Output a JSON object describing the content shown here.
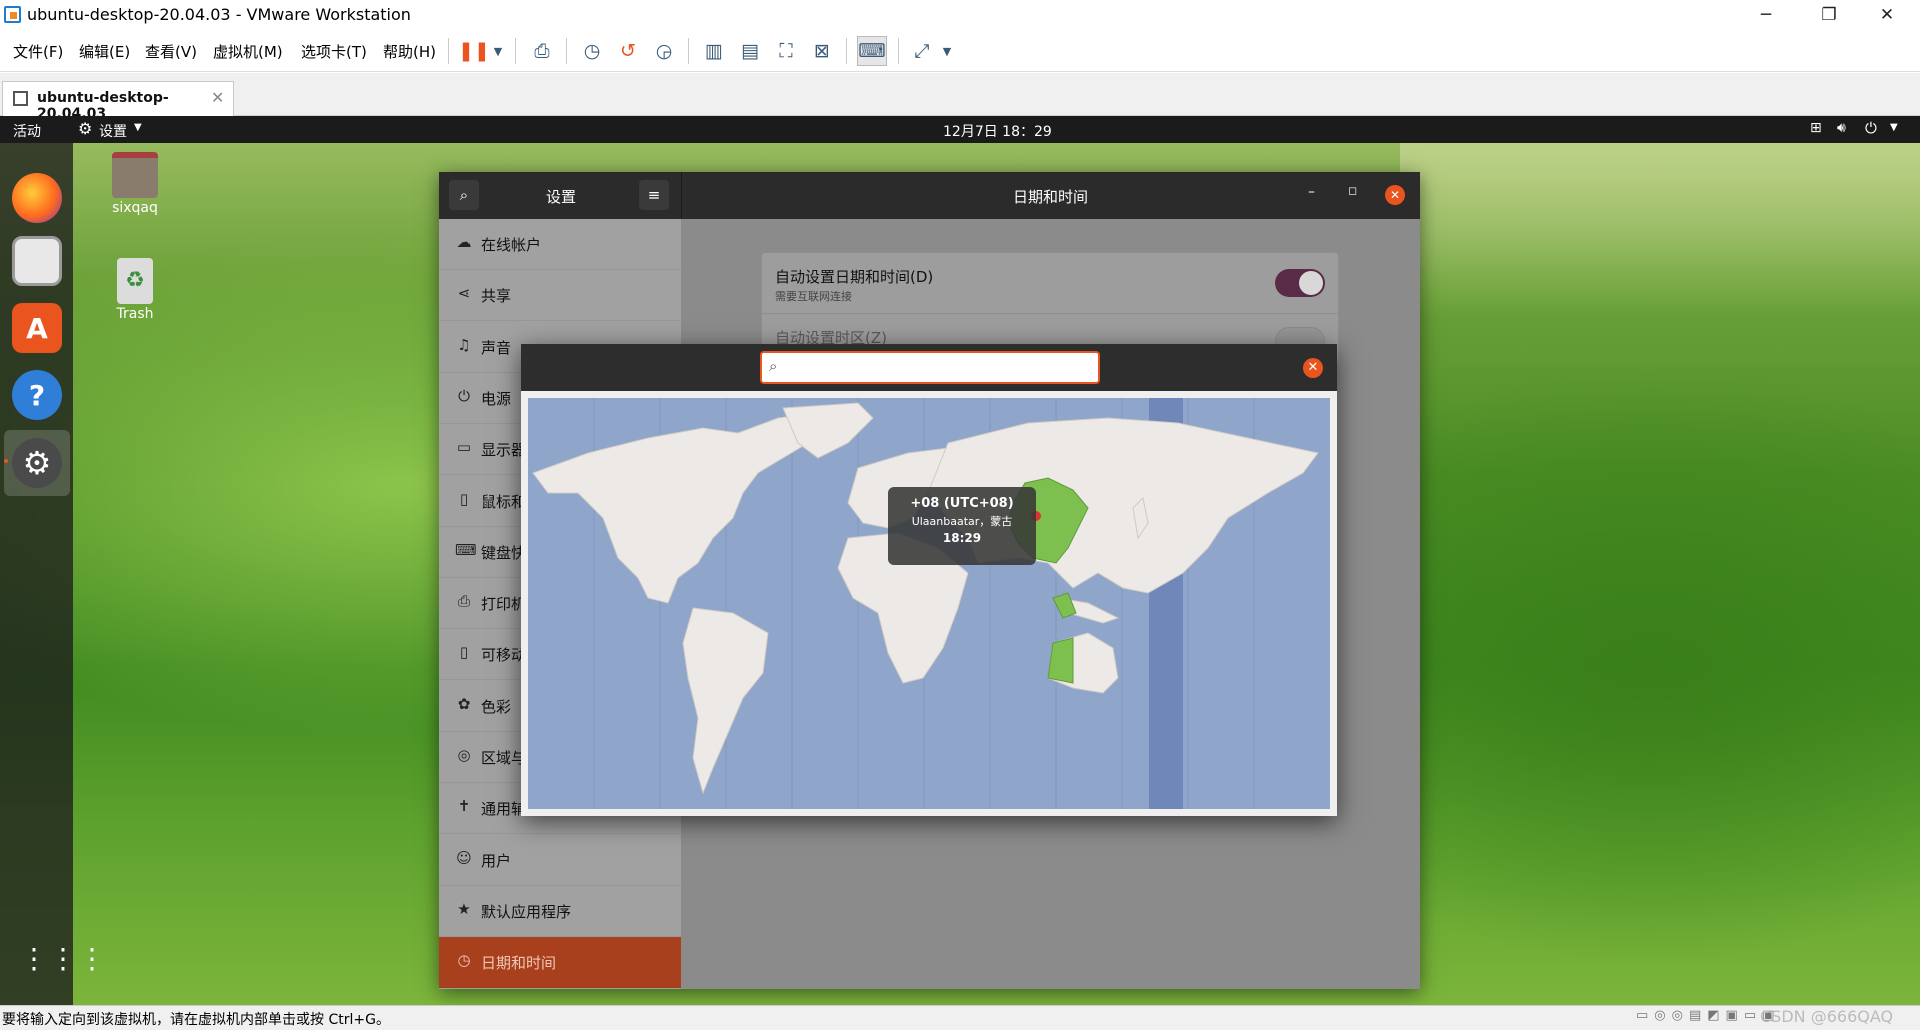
{
  "window": {
    "title": "ubuntu-desktop-20.04.03 - VMware Workstation",
    "minimize": "─",
    "restore": "❐",
    "close": "✕"
  },
  "menubar": [
    "文件(F)",
    "编辑(E)",
    "查看(V)",
    "虚拟机(M)",
    "选项卡(T)",
    "帮助(H)"
  ],
  "toolbar_icons": [
    "pause-icon",
    "dropdown-icon",
    "send-keys-icon",
    "snapshot-icon",
    "revert-snapshot-icon",
    "snapshot-manager-icon",
    "library-view-icon",
    "thumbnail-view-icon",
    "fullscreen-icon",
    "unity-icon",
    "console-view-icon",
    "stretch-icon",
    "dropdown-icon"
  ],
  "tab": {
    "label": "ubuntu-desktop-20.04.03",
    "close": "✕"
  },
  "ubuntu_topbar": {
    "activities": "活动",
    "app_menu": "设置",
    "clock": "12月7日  18：29"
  },
  "desktop_icons": [
    {
      "label": "sixqaq"
    },
    {
      "label": "Trash"
    }
  ],
  "settings": {
    "sidebar_title": "设置",
    "panel_title": "日期和时间",
    "sidebar_items": [
      {
        "label": "在线帐户",
        "icon": "cloud-icon",
        "glyph": "☁"
      },
      {
        "label": "共享",
        "icon": "share-icon",
        "glyph": "⋖"
      },
      {
        "label": "声音",
        "icon": "music-icon",
        "glyph": "♫"
      },
      {
        "label": "电源",
        "icon": "power-icon",
        "glyph": "⏻"
      },
      {
        "label": "显示器",
        "icon": "display-icon",
        "glyph": "▭"
      },
      {
        "label": "鼠标和",
        "icon": "mouse-icon",
        "glyph": "▯"
      },
      {
        "label": "键盘快",
        "icon": "keyboard-icon",
        "glyph": "⌨"
      },
      {
        "label": "打印机",
        "icon": "printer-icon",
        "glyph": "⎙"
      },
      {
        "label": "可移动",
        "icon": "removable-media-icon",
        "glyph": "▯"
      },
      {
        "label": "色彩",
        "icon": "color-icon",
        "glyph": "✿"
      },
      {
        "label": "区域与",
        "icon": "globe-icon",
        "glyph": "◎"
      },
      {
        "label": "通用辅",
        "icon": "accessibility-icon",
        "glyph": "✝"
      },
      {
        "label": "用户",
        "icon": "users-icon",
        "glyph": "☺"
      },
      {
        "label": "默认应用程序",
        "icon": "star-icon",
        "glyph": "★"
      },
      {
        "label": "日期和时间",
        "icon": "clock-icon",
        "glyph": "◷",
        "active": true
      }
    ],
    "auto_datetime": {
      "label": "自动设置日期和时间(D)",
      "sublabel": "需要互联网连接",
      "enabled": true
    },
    "auto_timezone": {
      "label": "自动设置时区(Z)",
      "enabled": false
    }
  },
  "timezone_dialog": {
    "search_value": "",
    "tooltip": {
      "zone": "+08 (UTC+08)",
      "city": "Ulaanbaatar，蒙古",
      "time": "18:29"
    }
  },
  "statusbar": {
    "message": "要将输入定向到该虚拟机，请在虚拟机内部单击或按 Ctrl+G。",
    "watermark": "CSDN @666QAQ"
  },
  "colors": {
    "accent": "#e9541f",
    "active_item": "#a8401e",
    "toggle_on": "#5a2b47",
    "map_water": "#8fa5c9",
    "map_highlight": "#7ec04f"
  }
}
